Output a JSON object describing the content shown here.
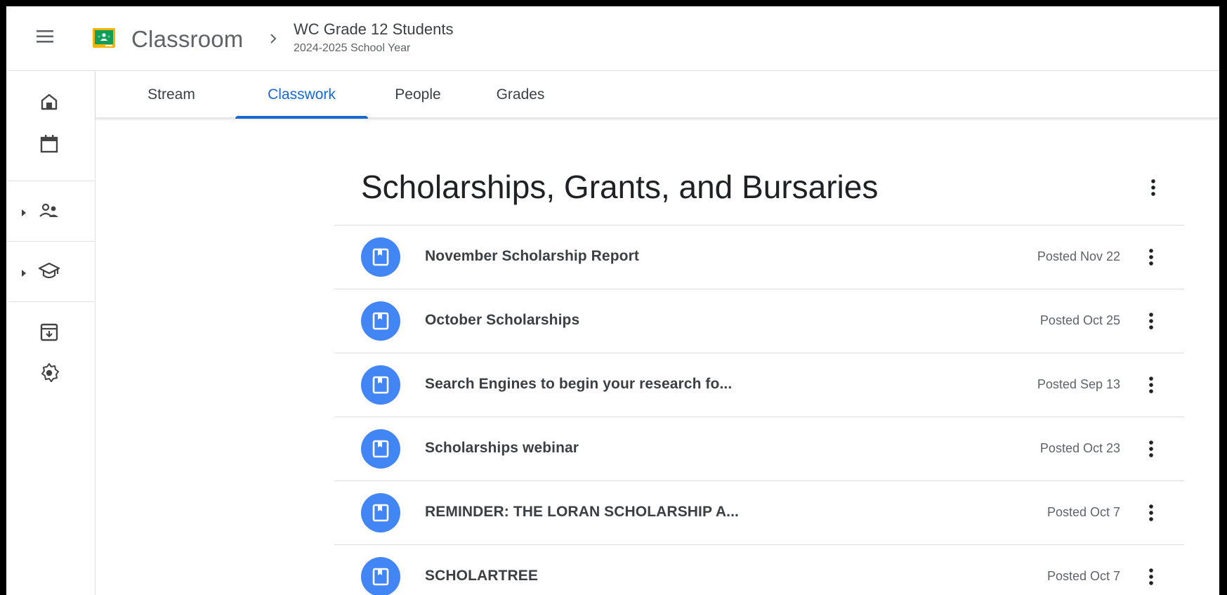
{
  "header": {
    "app_name": "Classroom",
    "class_name": "WC Grade 12 Students",
    "class_subtitle": "2024-2025 School Year"
  },
  "tabs": [
    {
      "label": "Stream",
      "active": false
    },
    {
      "label": "Classwork",
      "active": true
    },
    {
      "label": "People",
      "active": false
    },
    {
      "label": "Grades",
      "active": false
    }
  ],
  "rail": {
    "items": [
      "home-icon",
      "calendar-icon",
      "enrolled-people-icon",
      "teaching-cap-icon",
      "archive-icon",
      "settings-icon"
    ]
  },
  "topic": {
    "title": "Scholarships, Grants, and Bursaries",
    "items": [
      {
        "title": "November Scholarship Report",
        "date": "Posted Nov 22"
      },
      {
        "title": "October Scholarships",
        "date": "Posted Oct 25"
      },
      {
        "title": "Search Engines to begin your research fo...",
        "date": "Posted Sep 13"
      },
      {
        "title": "Scholarships webinar",
        "date": "Posted Oct 23"
      },
      {
        "title": "REMINDER: THE LORAN SCHOLARSHIP A...",
        "date": "Posted Oct 7"
      },
      {
        "title": "SCHOLARTREE",
        "date": "Posted Oct 7"
      }
    ]
  },
  "colors": {
    "accent": "#1967d2",
    "material_badge": "#4285f4",
    "logo_green": "#0f9d58",
    "logo_yellow": "#f4b400"
  }
}
